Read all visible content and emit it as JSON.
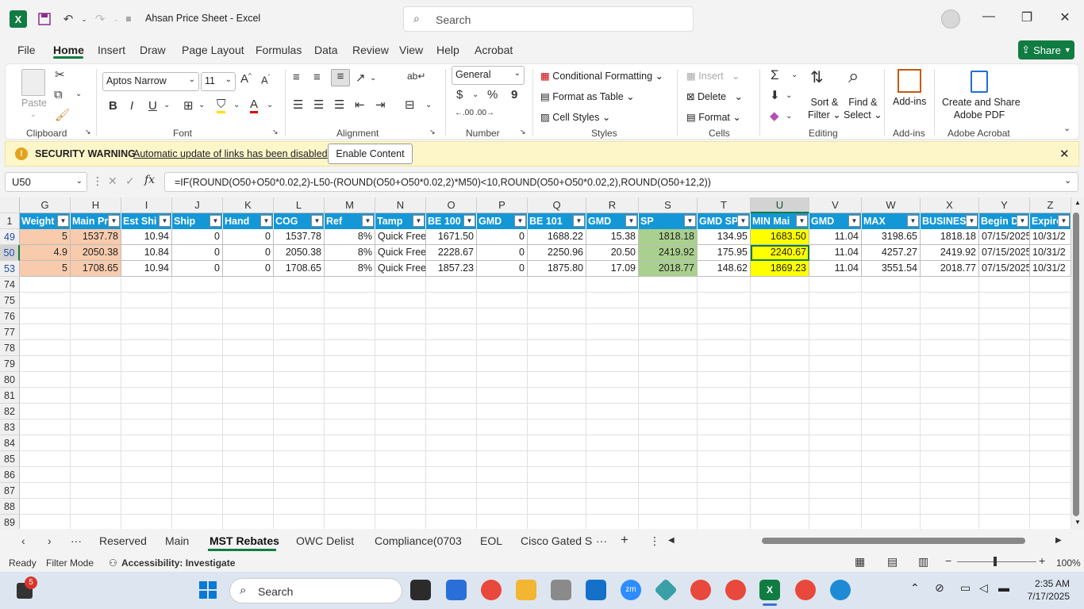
{
  "titlebar": {
    "app_logo": "X",
    "doc_title": "Ahsan Price Sheet  -  Excel",
    "search_placeholder": "Search"
  },
  "menu": {
    "items": [
      "File",
      "Home",
      "Insert",
      "Draw",
      "Page Layout",
      "Formulas",
      "Data",
      "Review",
      "View",
      "Help",
      "Acrobat"
    ],
    "share_label": "Share"
  },
  "ribbon": {
    "clipboard": {
      "paste": "Paste",
      "label": "Clipboard"
    },
    "font": {
      "family": "Aptos Narrow",
      "size": "11",
      "label": "Font"
    },
    "alignment": {
      "label": "Alignment"
    },
    "number": {
      "format": "General",
      "label": "Number"
    },
    "styles": {
      "conditional": "Conditional Formatting",
      "format_table": "Format as Table",
      "cell_styles": "Cell Styles",
      "label": "Styles"
    },
    "cells": {
      "insert": "Insert",
      "delete": "Delete",
      "format": "Format",
      "label": "Cells"
    },
    "editing": {
      "sort": "Sort &",
      "filter": "Filter",
      "find": "Find &",
      "select": "Select",
      "label": "Editing"
    },
    "addins": {
      "button": "Add-ins",
      "label": "Add-ins"
    },
    "acrobat": {
      "line1": "Create and Share",
      "line2": "Adobe PDF",
      "label": "Adobe Acrobat"
    }
  },
  "security": {
    "title": "SECURITY WARNING",
    "message": "Automatic update of links has been disabled",
    "button": "Enable Content"
  },
  "formula_bar": {
    "name_box": "U50",
    "fx": "fx",
    "formula": "=IF(ROUND(O50+O50*0.02,2)-L50-(ROUND(O50+O50*0.02,2)*M50)<10,ROUND(O50+O50*0.02,2),ROUND(O50+12,2))"
  },
  "grid": {
    "columns": [
      "G",
      "H",
      "I",
      "J",
      "K",
      "L",
      "M",
      "N",
      "O",
      "P",
      "Q",
      "R",
      "S",
      "T",
      "U",
      "V",
      "W",
      "X",
      "Y",
      "Z"
    ],
    "headers": [
      "Weight",
      "Main Pr",
      "Est Shi",
      "Ship",
      "Hand",
      "COG",
      "Ref",
      "Tamp",
      "BE 100",
      "GMD",
      "BE 101",
      "GMD",
      "SP",
      "GMD SP",
      "MIN Mai",
      "GMD",
      "MAX",
      "BUSINES",
      "Begin D",
      "Expire"
    ],
    "row_numbers": [
      "1",
      "49",
      "50",
      "53",
      "74",
      "75",
      "76",
      "77",
      "78",
      "79",
      "80",
      "81",
      "82",
      "83",
      "84",
      "85",
      "86",
      "87",
      "88",
      "89"
    ],
    "rows": [
      [
        "5",
        "1537.78",
        "10.94",
        "0",
        "0",
        "1537.78",
        "8%",
        "Quick Free",
        "1671.50",
        "0",
        "1688.22",
        "15.38",
        "1818.18",
        "134.95",
        "1683.50",
        "11.04",
        "3198.65",
        "1818.18",
        "07/15/2025",
        "10/31/2"
      ],
      [
        "4.9",
        "2050.38",
        "10.84",
        "0",
        "0",
        "2050.38",
        "8%",
        "Quick Free",
        "2228.67",
        "0",
        "2250.96",
        "20.50",
        "2419.92",
        "175.95",
        "2240.67",
        "11.04",
        "4257.27",
        "2419.92",
        "07/15/2025",
        "10/31/2"
      ],
      [
        "5",
        "1708.65",
        "10.94",
        "0",
        "0",
        "1708.65",
        "8%",
        "Quick Free",
        "1857.23",
        "0",
        "1875.80",
        "17.09",
        "2018.77",
        "148.62",
        "1869.23",
        "11.04",
        "3551.54",
        "2018.77",
        "07/15/2025",
        "10/31/2"
      ]
    ]
  },
  "sheets": {
    "tabs": [
      "Reserved",
      "Main",
      "MST Rebates",
      "OWC Delist",
      "Compliance(0703",
      "EOL",
      "Cisco Gated S"
    ],
    "active": "MST Rebates"
  },
  "status": {
    "ready": "Ready",
    "mode": "Filter Mode",
    "accessibility": "Accessibility: Investigate",
    "zoom": "100%"
  },
  "taskbar": {
    "search": "Search",
    "badge": "5",
    "time": "2:35 AM",
    "date": "7/17/2025"
  }
}
